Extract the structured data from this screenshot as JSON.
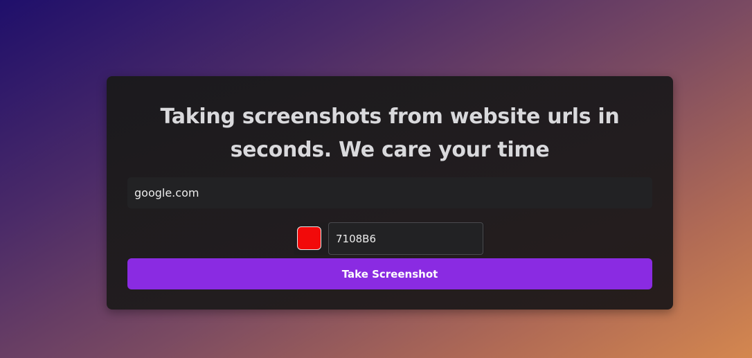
{
  "form": {
    "title": "Taking screenshots from website urls in seconds. We care your time",
    "url_value": "google.com",
    "color_hex": "7108B6",
    "swatch_color": "#f20a0a",
    "submit_label": "Take Screenshot"
  },
  "colors": {
    "accent": "#8a2be2"
  }
}
